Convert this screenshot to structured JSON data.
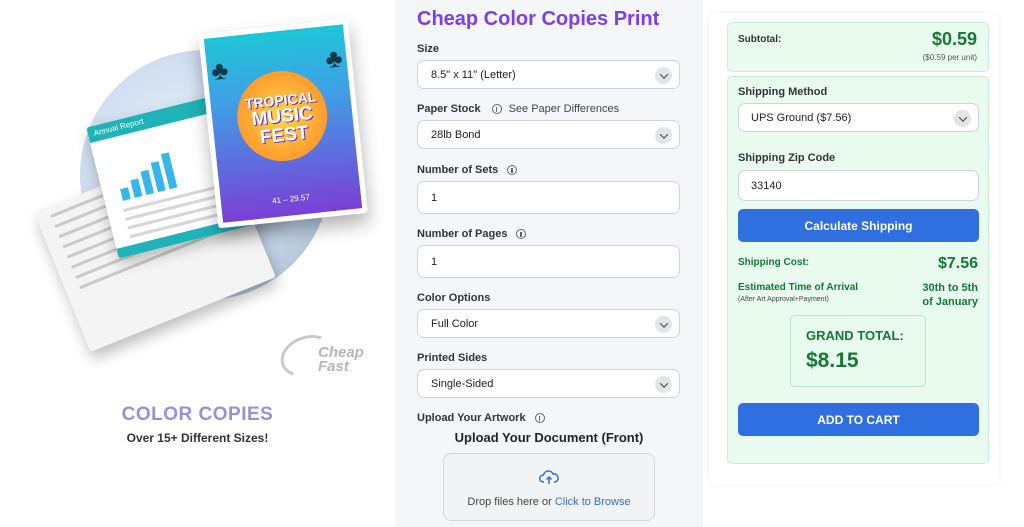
{
  "left": {
    "title": "COLOR COPIES",
    "subtitle": "Over 15+ Different Sizes!",
    "poster": {
      "line1": "TROPICAL",
      "line2": "MUSIC",
      "line3": "FEST",
      "date": "41 – 29.57"
    },
    "report_header": "Annual Report",
    "watermark": {
      "line1": "Cheap",
      "line2": "Fast"
    }
  },
  "form": {
    "title": "Cheap Color Copies Print",
    "size": {
      "label": "Size",
      "value": "8.5\" x 11\" (Letter)"
    },
    "paper_stock": {
      "label": "Paper Stock",
      "link": "See Paper Differences",
      "value": "28lb Bond"
    },
    "sets": {
      "label": "Number of Sets",
      "value": "1"
    },
    "pages": {
      "label": "Number of Pages",
      "value": "1"
    },
    "color": {
      "label": "Color Options",
      "value": "Full Color"
    },
    "sides": {
      "label": "Printed Sides",
      "value": "Single-Sided"
    },
    "upload": {
      "label": "Upload Your Artwork",
      "title": "Upload Your Document (Front)",
      "drop_text": "Drop files here or ",
      "drop_link": "Click to Browse"
    }
  },
  "summary": {
    "subtotal_label": "Subtotal:",
    "subtotal": "$0.59",
    "per_unit": "($0.59 per unit)",
    "shipping_method_label": "Shipping Method",
    "shipping_method": "UPS Ground ($7.56)",
    "zip_label": "Shipping Zip Code",
    "zip": "33140",
    "calc_button": "Calculate Shipping",
    "shipping_cost_label": "Shipping Cost:",
    "shipping_cost": "$7.56",
    "eta_label": "Estimated Time of Arrival",
    "eta_note": "(After Art Approval+Payment)",
    "eta_line1": "30th to 5th",
    "eta_line2": "of January",
    "grand_total_label": "GRAND TOTAL:",
    "grand_total": "$8.15",
    "add_to_cart": "ADD TO CART"
  },
  "colors": {
    "accent_purple": "#7b3ff2",
    "button_blue": "#2f6fe0",
    "price_green": "#137a36",
    "summary_bg": "#e9fbef"
  }
}
